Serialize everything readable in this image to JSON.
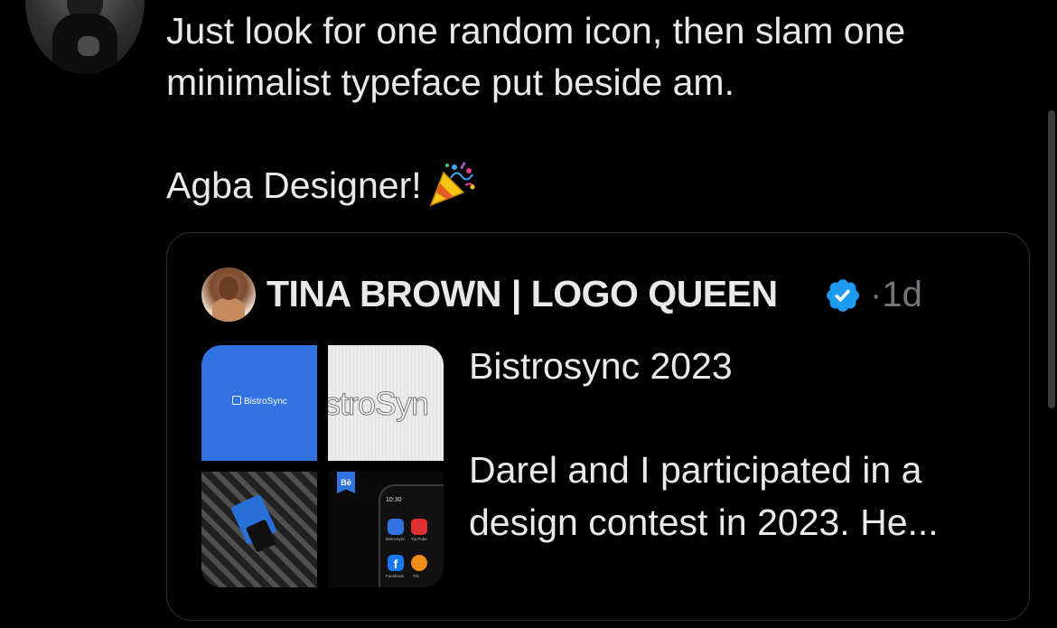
{
  "tweet": {
    "line1": "Just look for one random icon, then slam one",
    "line2": "minimalist typeface put beside am.",
    "line3": "Agba Designer!",
    "emoji": "party-popper-icon"
  },
  "quote": {
    "author": "TINA BROWN | LOGO QUEEN",
    "separator": "·",
    "time": "1d",
    "title": "Bistrosync 2023",
    "body_line1": "Darel and I participated in a",
    "body_line2": "design contest in 2023. He..."
  },
  "media": {
    "brand": "BistroSync",
    "word": "stroSyn",
    "behance": "Bē",
    "phone_time": "10:30",
    "app1": "BistroSync",
    "app2": "YouTube",
    "app3": "Facebook",
    "app4": "Tra"
  },
  "colors": {
    "background": "#000000",
    "text": "#e7e9ea",
    "muted": "#71767b",
    "border": "#2f3336",
    "verified": "#1d9bf0",
    "brand_blue": "#2f72e0"
  }
}
